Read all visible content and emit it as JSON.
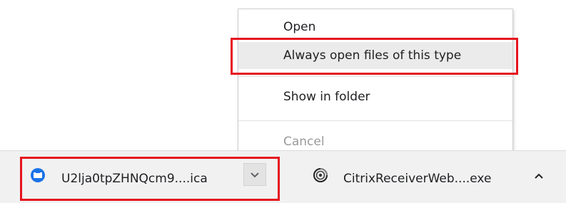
{
  "context_menu": {
    "items": [
      {
        "label": "Open",
        "enabled": true
      },
      {
        "label": "Always open files of this type",
        "enabled": true,
        "hovered": true
      },
      {
        "label": "Show in folder",
        "enabled": true
      },
      {
        "label": "Cancel",
        "enabled": false
      }
    ]
  },
  "download_shelf": {
    "items": [
      {
        "file_name": "U2lja0tpZHNQcm9....ica",
        "icon": "ica-file-icon"
      },
      {
        "file_name": "CitrixReceiverWeb....exe",
        "icon": "citrix-installer-icon"
      }
    ],
    "expand_icon": "chevron-up-icon"
  },
  "colors": {
    "highlight": "#e5141f",
    "hover_background": "#ebebeb",
    "shelf_background": "#f1f1f1",
    "ica_icon": "#1a73e8",
    "disabled_text": "#9a9a9a"
  }
}
